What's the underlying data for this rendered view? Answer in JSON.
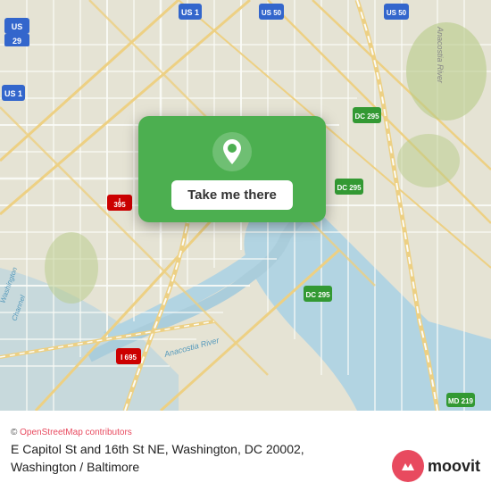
{
  "map": {
    "alt": "Map of Washington DC area",
    "popup": {
      "button_label": "Take me there"
    }
  },
  "bottom_bar": {
    "attribution": "© OpenStreetMap contributors",
    "location_line1": "E Capitol St and 16th St NE, Washington, DC 20002,",
    "location_line2": "Washington / Baltimore"
  },
  "moovit": {
    "logo_text": "moovit"
  }
}
